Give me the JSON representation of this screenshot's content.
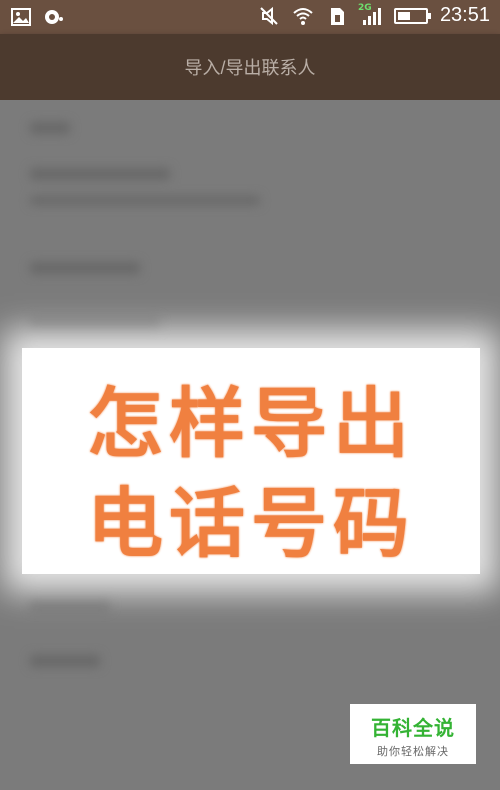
{
  "status_bar": {
    "time": "23:51",
    "network_type": "2G",
    "battery_level": 0.45,
    "icons": [
      "image-icon",
      "notification-icon",
      "mute-icon",
      "wifi-icon",
      "sim-icon",
      "signal-icon",
      "battery-icon"
    ]
  },
  "header": {
    "title": "导入/导出联系人"
  },
  "overlay": {
    "line1": "怎样导出",
    "line2": "电话号码"
  },
  "watermark": {
    "title": "百科全说",
    "subtitle": "助你轻松解决"
  }
}
